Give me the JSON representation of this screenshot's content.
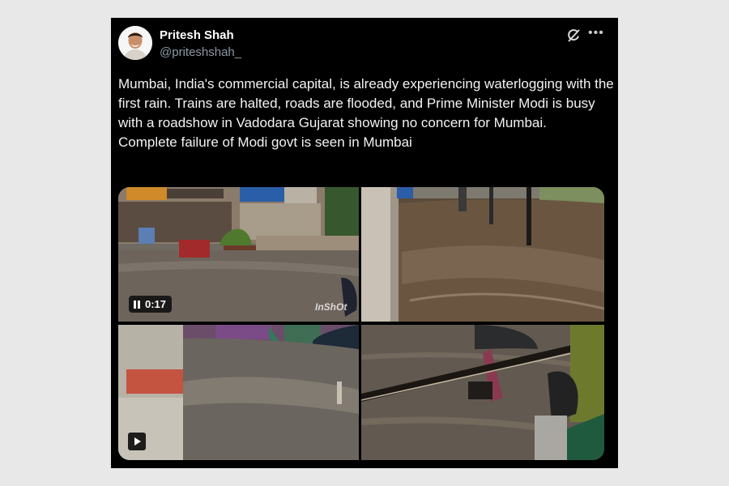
{
  "post": {
    "author_name": "Pritesh Shah",
    "author_handle": "@priteshshah_",
    "text": "Mumbai, India's commercial capital, is already experiencing waterlogging with the first rain. Trains are halted, roads are flooded, and Prime Minister Modi is busy with a roadshow in Vadodara Gujarat showing no concern for Mumbai.\n Complete failure of Modi govt is seen in Mumbai"
  },
  "media": {
    "video1": {
      "duration": "0:17",
      "watermark": "InShOt",
      "icon": "pause-icon"
    },
    "video3": {
      "icon": "play-icon"
    }
  },
  "icons": {
    "grok": "grok-icon",
    "more": "more-icon"
  },
  "colors": {
    "card_background": "#000000",
    "page_background": "#e8e8e8",
    "handle_gray": "#8b98a5",
    "text": "#e7e9ea"
  }
}
